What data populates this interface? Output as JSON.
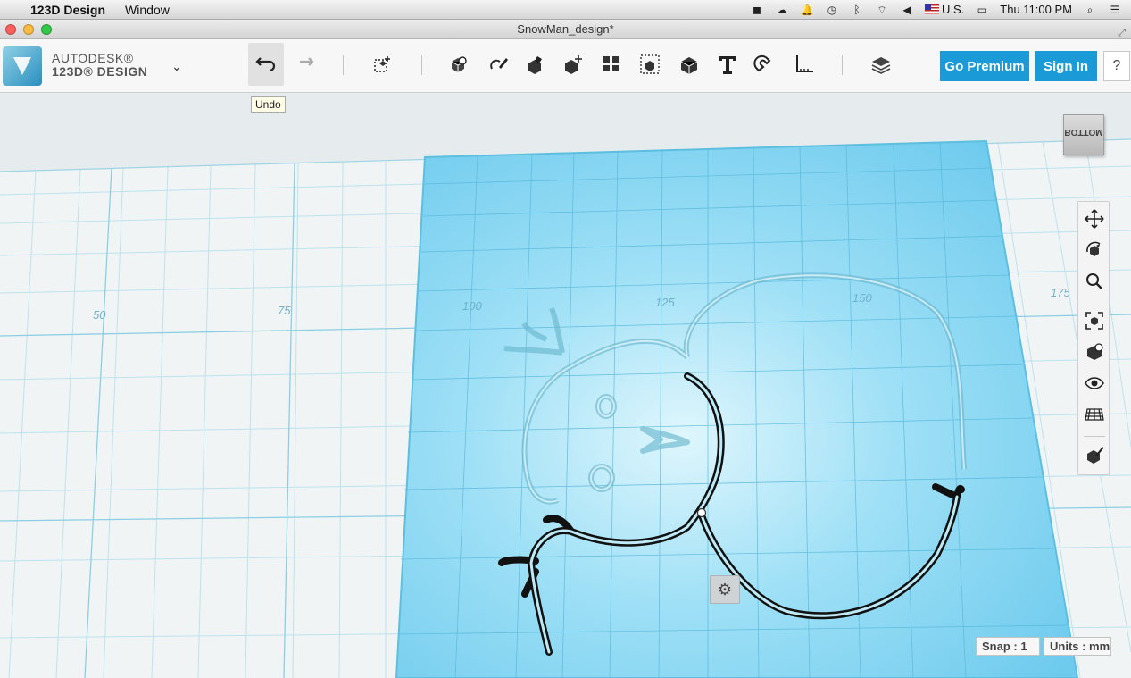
{
  "menubar": {
    "app_name": "123D Design",
    "menus": [
      "Window"
    ],
    "input_source": "U.S.",
    "clock": "Thu 11:00 PM"
  },
  "window": {
    "title": "SnowMan_design*"
  },
  "brand": {
    "line1": "AUTODESK®",
    "line2": "123D® DESIGN"
  },
  "toolbar": {
    "undo_tooltip": "Undo",
    "go_premium_label": "Go Premium",
    "sign_in_label": "Sign In",
    "help_label": "?",
    "tools": [
      "undo-icon",
      "redo-icon",
      "transform-icon",
      "primitives-icon",
      "sketch-icon",
      "construct-icon",
      "modify-icon",
      "pattern-icon",
      "grouping-icon",
      "combine-icon",
      "text-icon",
      "snap-icon",
      "measure-icon",
      "material-icon"
    ]
  },
  "viewport": {
    "grid_labels": [
      "50",
      "75",
      "100",
      "125",
      "150",
      "175"
    ],
    "viewcube_label": "BOTTOM",
    "plane_color": "#6fcbee",
    "sketch_color": "#111111",
    "snap_label": "Snap : 1",
    "units_label": "Units : mm"
  },
  "nav_panel": {
    "buttons": [
      "pan-icon",
      "orbit-icon",
      "zoom-icon",
      "fit-icon",
      "views-icon",
      "visibility-icon",
      "grid-icon",
      "material-icon"
    ]
  }
}
